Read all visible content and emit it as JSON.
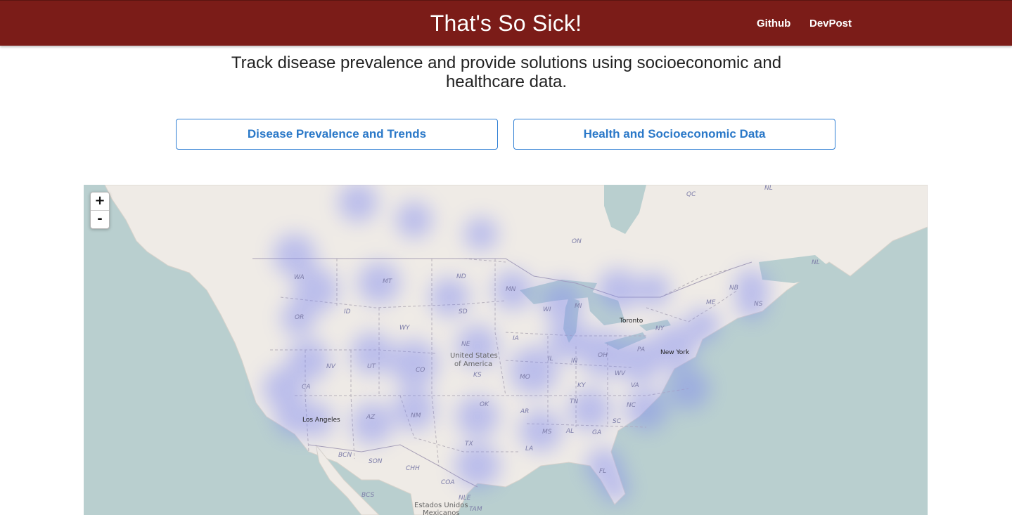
{
  "header": {
    "title": "That's So Sick!",
    "links": [
      "Github",
      "DevPost"
    ]
  },
  "tagline": {
    "line1": "Track disease prevalence and provide solutions using socioeconomic and",
    "line2": "healthcare data."
  },
  "buttons": {
    "disease": "Disease Prevalence and Trends",
    "socio": "Health and Socioeconomic Data"
  },
  "map": {
    "zoom_in": "+",
    "zoom_out": "-",
    "labels": {
      "wa": "WA",
      "or": "OR",
      "id": "ID",
      "mt": "MT",
      "nd": "ND",
      "mn": "MN",
      "sd": "SD",
      "wy": "WY",
      "ne": "NE",
      "ia": "IA",
      "wi": "WI",
      "mi": "MI",
      "nv": "NV",
      "ut": "UT",
      "co": "CO",
      "ks": "KS",
      "mo": "MO",
      "il": "IL",
      "in": "IN",
      "oh": "OH",
      "pa": "PA",
      "ny": "NY",
      "me": "ME",
      "ca": "CA",
      "az": "AZ",
      "nm": "NM",
      "ok": "OK",
      "ar": "AR",
      "tn": "TN",
      "ky": "KY",
      "wv": "WV",
      "va": "VA",
      "nc": "NC",
      "sc": "SC",
      "ga": "GA",
      "al": "AL",
      "ms": "MS",
      "la": "LA",
      "tx": "TX",
      "fl": "FL",
      "nb": "NB",
      "ns": "NS",
      "on": "ON",
      "qc": "QC",
      "nl1": "NL",
      "nl2": "NL",
      "bcn": "BCN",
      "son": "SON",
      "chh": "CHH",
      "coa": "COA",
      "nle": "NLE",
      "bcs": "BCS",
      "tam": "TAM"
    },
    "cities": {
      "toronto": "Toronto",
      "new_york": "New York",
      "los_angeles": "Los Angeles"
    },
    "country": {
      "us_line1": "United States",
      "us_line2": "of America",
      "mx_line1": "Estados Unidos",
      "mx_line2": "Mexicanos"
    }
  }
}
